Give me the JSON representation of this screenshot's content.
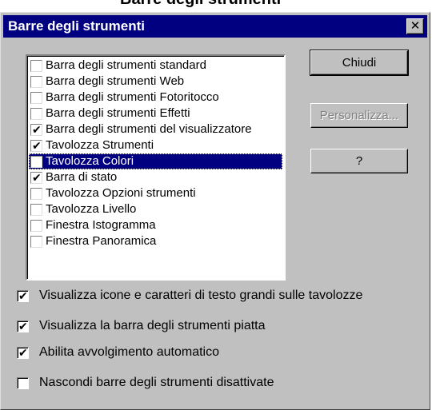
{
  "top_strip": {
    "clipped_text": "Barre degli strumenti"
  },
  "dialog": {
    "title": "Barre degli strumenti",
    "close_glyph": "✕"
  },
  "toolbar_list": [
    {
      "label": "Barra degli strumenti standard",
      "checked": false,
      "selected": false
    },
    {
      "label": "Barra degli strumenti Web",
      "checked": false,
      "selected": false
    },
    {
      "label": "Barra degli strumenti Fotoritocco",
      "checked": false,
      "selected": false
    },
    {
      "label": "Barra degli strumenti Effetti",
      "checked": false,
      "selected": false
    },
    {
      "label": "Barra degli strumenti del visualizzatore",
      "checked": true,
      "selected": false
    },
    {
      "label": "Tavolozza Strumenti",
      "checked": true,
      "selected": false
    },
    {
      "label": "Tavolozza Colori",
      "checked": false,
      "selected": true
    },
    {
      "label": "Barra di stato",
      "checked": true,
      "selected": false
    },
    {
      "label": "Tavolozza Opzioni strumenti",
      "checked": false,
      "selected": false
    },
    {
      "label": "Tavolozza Livello",
      "checked": false,
      "selected": false
    },
    {
      "label": "Finestra Istogramma",
      "checked": false,
      "selected": false
    },
    {
      "label": "Finestra Panoramica",
      "checked": false,
      "selected": false
    }
  ],
  "buttons": {
    "close_label": "Chiudi",
    "customize_label": "Personalizza...",
    "help_label": "?"
  },
  "options": [
    {
      "label": "Visualizza icone e caratteri di testo grandi sulle tavolozze",
      "checked": true
    },
    {
      "label": "Visualizza la barra degli strumenti piatta",
      "checked": true
    },
    {
      "label": "Abilita avvolgimento automatico",
      "checked": true
    },
    {
      "label": "Nascondi barre degli strumenti disattivate",
      "checked": false
    }
  ],
  "check_glyph": "✔"
}
